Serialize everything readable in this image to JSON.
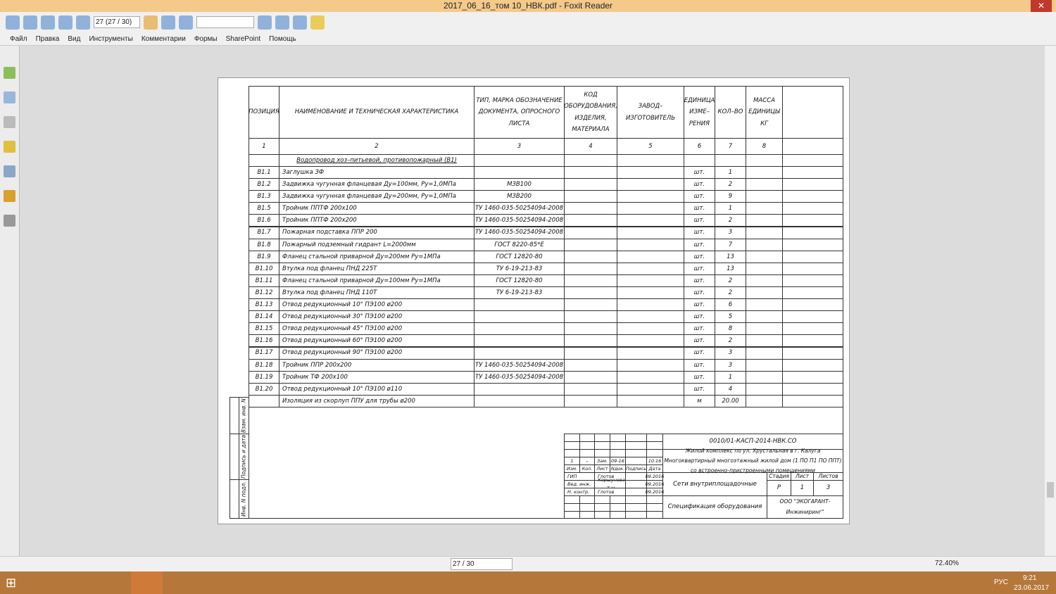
{
  "window": {
    "title": "2017_06_16_том 10_НВК.pdf - Foxit Reader"
  },
  "toolbar": {
    "page_field": "27 (27 / 30)",
    "search_placeholder": ""
  },
  "menu": [
    "Файл",
    "Правка",
    "Вид",
    "Инструменты",
    "Комментарии",
    "Формы",
    "SharePoint",
    "Помощь"
  ],
  "table": {
    "headers": [
      "ПОЗИЦИЯ",
      "НАИМЕНОВАНИЕ И ТЕХНИЧЕСКАЯ ХАРАКТЕРИСТИКА",
      "ТИП, МАРКА ОБОЗНАЧЕНИЕ ДОКУМЕНТА, ОПРОСНОГО ЛИСТА",
      "КОД ОБОРУДОВАНИЯ, ИЗДЕЛИЯ, МАТЕРИАЛА",
      "ЗАВОД–ИЗГОТОВИТЕЛЬ",
      "ЕДИНИЦА ИЗМЕ–РЕНИЯ",
      "КОЛ–ВО",
      "МАССА ЕДИНИЦЫ КГ",
      ""
    ],
    "numbers": [
      "1",
      "2",
      "3",
      "4",
      "5",
      "6",
      "7",
      "8",
      ""
    ],
    "section": "Водопровод хоз–питьевой, противопожарный (В1)",
    "rows": [
      [
        "В1.1",
        "Заглушка ЗФ",
        "",
        "шт.",
        "1"
      ],
      [
        "В1.2",
        "Задвижка чугунная фланцевая Ду=100мм, Ру=1,0МПа",
        "МЗВ100",
        "шт.",
        "2"
      ],
      [
        "В1.3",
        "Задвижка чугунная фланцевая Ду=200мм, Ру=1,0МПа",
        "МЗВ200",
        "шт.",
        "9"
      ],
      [
        "В1.5",
        "Тройник ППТФ 200х100",
        "ТУ 1460-035-50254094-2008",
        "шт.",
        "1"
      ],
      [
        "В1.6",
        "Тройник ППТФ 200х200",
        "ТУ 1460-035-50254094-2008",
        "шт.",
        "2"
      ],
      [
        "В1.7",
        "Пожарная подставка ППР 200",
        "ТУ 1460-035-50254094-2008",
        "шт.",
        "3"
      ],
      [
        "В1.8",
        "Пожарный подземный гидрант L=2000мм",
        "ГОСТ 8220-85*Е",
        "шт.",
        "7"
      ],
      [
        "В1.9",
        "Фланец стальной приварной Ду=200мм Ру=1МПа",
        "ГОСТ 12820-80",
        "шт.",
        "13"
      ],
      [
        "В1.10",
        "Втулка под фланец ПНД 225Т",
        "ТУ 6-19-213-83",
        "шт.",
        "13"
      ],
      [
        "В1.11",
        "Фланец стальной приварной Ду=100мм Ру=1МПа",
        "ГОСТ 12820-80",
        "шт.",
        "2"
      ],
      [
        "В1.12",
        "Втулка под фланец ПНД 110Т",
        "ТУ 6-19-213-83",
        "шт.",
        "2"
      ],
      [
        "В1.13",
        "Отвод редукционный 10° ПЭ100 ø200",
        "",
        "шт.",
        "6"
      ],
      [
        "В1.14",
        "Отвод редукционный 30° ПЭ100     ø200",
        "",
        "шт.",
        "5"
      ],
      [
        "В1.15",
        "Отвод редукционный 45° ПЭ100     ø200",
        "",
        "шт.",
        "8"
      ],
      [
        "В1.16",
        "Отвод редукционный 60° ПЭ100     ø200",
        "",
        "шт.",
        "2"
      ],
      [
        "В1.17",
        "Отвод редукционный 90° ПЭ100     ø200",
        "",
        "шт.",
        "3"
      ],
      [
        "В1.18",
        "Тройник ППР 200х200",
        "ТУ 1460-035-50254094-2008",
        "шт.",
        "3"
      ],
      [
        "В1.19",
        "Тройник ТФ 200х100",
        "ТУ 1460-035-50254094-2008",
        "шт.",
        "1"
      ],
      [
        "В1.20",
        "Отвод редукционный 10° ПЭ100 ø110",
        "",
        "шт.",
        "4"
      ],
      [
        "",
        "Изоляция из скорлуп ППУ для трубы ø200",
        "",
        "м",
        "20.00"
      ]
    ]
  },
  "side_labels": [
    "Взам. инв. N",
    "Подпись и дата",
    "Инв. N подл."
  ],
  "stamp": {
    "code": "0010/01-КАСП-2014-НВК.СО",
    "project": "Жилой комплекс по ул. Хрустальная в г. Калуга Многоквартирный многоэтажный жилой дом (1 ПО П1 ПО ППТ) со встроенно-пристроенными помещениями",
    "rev": [
      "1",
      "–",
      "Зам.",
      "09-16",
      "",
      "10.16"
    ],
    "head": [
      "Изм.",
      "Кол.",
      "Лист",
      "Nдок.",
      "Подпись",
      "Дата"
    ],
    "people": [
      [
        "ГИП",
        "Глотов",
        "09.2016"
      ],
      [
        "Вед. инж.",
        "Коршунова Т.Н.",
        "09.2016"
      ],
      [
        "Н. контр.",
        "Глотов",
        "09.2016"
      ]
    ],
    "stage_head": [
      "Стадия",
      "Лист",
      "Листов"
    ],
    "stage_vals": [
      "Р",
      "1",
      "3"
    ],
    "section_title": "Сети внутриплощадочные",
    "doc_title": "Спецификация оборудования",
    "company": "ООО \"ЭКОГАРАНТ-Инжиниринг\""
  },
  "status": {
    "page_field": "27 / 30",
    "zoom": "72.40%"
  },
  "taskbar": {
    "time": "9:21",
    "date": "23.06.2017",
    "lang": "РУС"
  }
}
